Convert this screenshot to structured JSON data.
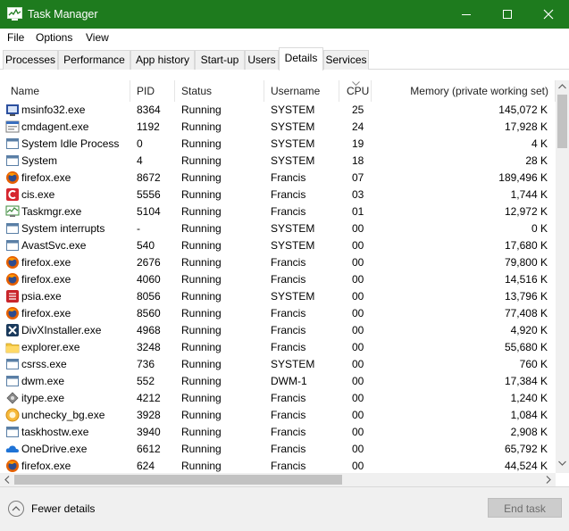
{
  "window": {
    "title": "Task Manager",
    "icon": "task-manager-icon",
    "title_bar_color": "#1e7b1e"
  },
  "menu": [
    "File",
    "Options",
    "View"
  ],
  "tabs": [
    {
      "label": "Processes"
    },
    {
      "label": "Performance"
    },
    {
      "label": "App history"
    },
    {
      "label": "Start-up"
    },
    {
      "label": "Users"
    },
    {
      "label": "Details",
      "active": true
    },
    {
      "label": "Services"
    }
  ],
  "columns": {
    "name": "Name",
    "pid": "PID",
    "status": "Status",
    "username": "Username",
    "cpu": "CPU",
    "memory": "Memory (private working set)",
    "sorted_by": "CPU"
  },
  "processes": [
    {
      "icon": "msinfo-icon",
      "name": "msinfo32.exe",
      "pid": "8364",
      "status": "Running",
      "user": "SYSTEM",
      "cpu": "25",
      "mem": "145,072 K"
    },
    {
      "icon": "comodo-icon",
      "name": "cmdagent.exe",
      "pid": "1192",
      "status": "Running",
      "user": "SYSTEM",
      "cpu": "24",
      "mem": "17,928 K"
    },
    {
      "icon": "window-app-icon",
      "name": "System Idle Process",
      "pid": "0",
      "status": "Running",
      "user": "SYSTEM",
      "cpu": "19",
      "mem": "4 K"
    },
    {
      "icon": "window-app-icon",
      "name": "System",
      "pid": "4",
      "status": "Running",
      "user": "SYSTEM",
      "cpu": "18",
      "mem": "28 K"
    },
    {
      "icon": "firefox-icon",
      "name": "firefox.exe",
      "pid": "8672",
      "status": "Running",
      "user": "Francis",
      "cpu": "07",
      "mem": "189,496 K"
    },
    {
      "icon": "comodo-red-icon",
      "name": "cis.exe",
      "pid": "5556",
      "status": "Running",
      "user": "Francis",
      "cpu": "03",
      "mem": "1,744 K"
    },
    {
      "icon": "task-manager-icon",
      "name": "Taskmgr.exe",
      "pid": "5104",
      "status": "Running",
      "user": "Francis",
      "cpu": "01",
      "mem": "12,972 K"
    },
    {
      "icon": "window-app-icon",
      "name": "System interrupts",
      "pid": "-",
      "status": "Running",
      "user": "SYSTEM",
      "cpu": "00",
      "mem": "0 K"
    },
    {
      "icon": "window-app-icon",
      "name": "AvastSvc.exe",
      "pid": "540",
      "status": "Running",
      "user": "SYSTEM",
      "cpu": "00",
      "mem": "17,680 K"
    },
    {
      "icon": "firefox-icon",
      "name": "firefox.exe",
      "pid": "2676",
      "status": "Running",
      "user": "Francis",
      "cpu": "00",
      "mem": "79,800 K"
    },
    {
      "icon": "firefox-icon",
      "name": "firefox.exe",
      "pid": "4060",
      "status": "Running",
      "user": "Francis",
      "cpu": "00",
      "mem": "14,516 K"
    },
    {
      "icon": "psia-icon",
      "name": "psia.exe",
      "pid": "8056",
      "status": "Running",
      "user": "SYSTEM",
      "cpu": "00",
      "mem": "13,796 K"
    },
    {
      "icon": "firefox-icon",
      "name": "firefox.exe",
      "pid": "8560",
      "status": "Running",
      "user": "Francis",
      "cpu": "00",
      "mem": "77,408 K"
    },
    {
      "icon": "divx-icon",
      "name": "DivXInstaller.exe",
      "pid": "4968",
      "status": "Running",
      "user": "Francis",
      "cpu": "00",
      "mem": "4,920 K"
    },
    {
      "icon": "folder-icon",
      "name": "explorer.exe",
      "pid": "3248",
      "status": "Running",
      "user": "Francis",
      "cpu": "00",
      "mem": "55,680 K"
    },
    {
      "icon": "window-app-icon",
      "name": "csrss.exe",
      "pid": "736",
      "status": "Running",
      "user": "SYSTEM",
      "cpu": "00",
      "mem": "760 K"
    },
    {
      "icon": "window-app-icon",
      "name": "dwm.exe",
      "pid": "552",
      "status": "Running",
      "user": "DWM-1",
      "cpu": "00",
      "mem": "17,384 K"
    },
    {
      "icon": "itype-icon",
      "name": "itype.exe",
      "pid": "4212",
      "status": "Running",
      "user": "Francis",
      "cpu": "00",
      "mem": "1,240 K"
    },
    {
      "icon": "unchecky-icon",
      "name": "unchecky_bg.exe",
      "pid": "3928",
      "status": "Running",
      "user": "Francis",
      "cpu": "00",
      "mem": "1,084 K"
    },
    {
      "icon": "window-app-icon",
      "name": "taskhostw.exe",
      "pid": "3940",
      "status": "Running",
      "user": "Francis",
      "cpu": "00",
      "mem": "2,908 K"
    },
    {
      "icon": "onedrive-icon",
      "name": "OneDrive.exe",
      "pid": "6612",
      "status": "Running",
      "user": "Francis",
      "cpu": "00",
      "mem": "65,792 K"
    },
    {
      "icon": "firefox-icon",
      "name": "firefox.exe",
      "pid": "624",
      "status": "Running",
      "user": "Francis",
      "cpu": "00",
      "mem": "44,524 K"
    }
  ],
  "footer": {
    "fewer_details": "Fewer details",
    "end_task": "End task"
  }
}
